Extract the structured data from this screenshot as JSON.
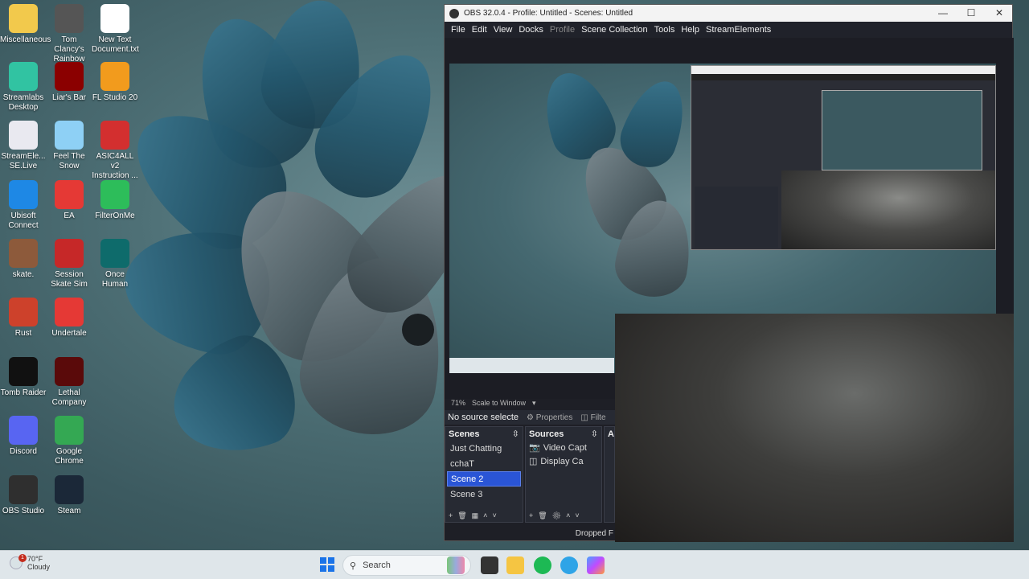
{
  "desktop": {
    "icons": [
      {
        "label": "Miscellaneous",
        "icon": "folder-icon",
        "color": "#f2c94c"
      },
      {
        "label": "Tom Clancy's Rainbow Si...",
        "icon": "rainbow-six-icon",
        "color": "#555555"
      },
      {
        "label": "New Text Document.txt",
        "icon": "text-file-icon",
        "color": "#ffffff"
      },
      {
        "label": "Streamlabs Desktop",
        "icon": "streamlabs-icon",
        "color": "#31c3a2"
      },
      {
        "label": "Liar's Bar",
        "icon": "liars-bar-icon",
        "color": "#8b0000"
      },
      {
        "label": "FL Studio 20",
        "icon": "fl-studio-icon",
        "color": "#f29b1d"
      },
      {
        "label": "StreamEle... SE.Live",
        "icon": "streamelements-icon",
        "color": "#e9e9f0"
      },
      {
        "label": "Feel The Snow",
        "icon": "heart-icon",
        "color": "#8ed0f5"
      },
      {
        "label": "ASIC4ALL v2 Instruction ...",
        "icon": "pdf-icon",
        "color": "#d32f2f"
      },
      {
        "label": "Ubisoft Connect",
        "icon": "ubisoft-icon",
        "color": "#1e88e5"
      },
      {
        "label": "EA",
        "icon": "ea-icon",
        "color": "#e53935"
      },
      {
        "label": "FilterOnMe",
        "icon": "filteronme-icon",
        "color": "#2dbd5a"
      },
      {
        "label": "skate.",
        "icon": "skate-icon",
        "color": "#8d5a3b"
      },
      {
        "label": "Session Skate Sim",
        "icon": "session-icon",
        "color": "#c62828"
      },
      {
        "label": "Once Human",
        "icon": "once-human-icon",
        "color": "#0e6b6b"
      },
      {
        "label": "Rust",
        "icon": "rust-icon",
        "color": "#cd412b"
      },
      {
        "label": "Undertale",
        "icon": "undertale-icon",
        "color": "#e53935"
      },
      {
        "label": "Tomb Raider",
        "icon": "tomb-raider-icon",
        "color": "#111111"
      },
      {
        "label": "Lethal Company",
        "icon": "lethal-company-icon",
        "color": "#5a0a0a"
      },
      {
        "label": "Discord",
        "icon": "discord-icon",
        "color": "#5865f2"
      },
      {
        "label": "Google Chrome",
        "icon": "chrome-icon",
        "color": "#34a853"
      },
      {
        "label": "OBS Studio",
        "icon": "obs-icon",
        "color": "#2f2f2f"
      },
      {
        "label": "Steam",
        "icon": "steam-icon",
        "color": "#1b2838"
      }
    ]
  },
  "taskbar": {
    "weather_temp": "70°F",
    "weather_desc": "Cloudy",
    "weather_badge": "1",
    "search_placeholder": "Search"
  },
  "obs": {
    "title": "OBS 32.0.4 - Profile: Untitled - Scenes: Untitled",
    "menu": [
      "File",
      "Edit",
      "View",
      "Docks",
      "Profile",
      "Scene Collection",
      "Tools",
      "Help",
      "StreamElements"
    ],
    "zoom": "71%",
    "scale_mode": "Scale to Window",
    "no_source": "No source selecte",
    "properties_tab": "Properties",
    "filters_tab": "Filte",
    "scenes_header": "Scenes",
    "sources_header": "Sources",
    "audio_header": "Au",
    "scenes": [
      "Just Chatting",
      "cchaT",
      "Scene 2",
      "Scene 3"
    ],
    "selected_scene": "Scene 2",
    "sources": [
      "Video Capt",
      "Display Ca"
    ],
    "status": "Dropped F"
  }
}
